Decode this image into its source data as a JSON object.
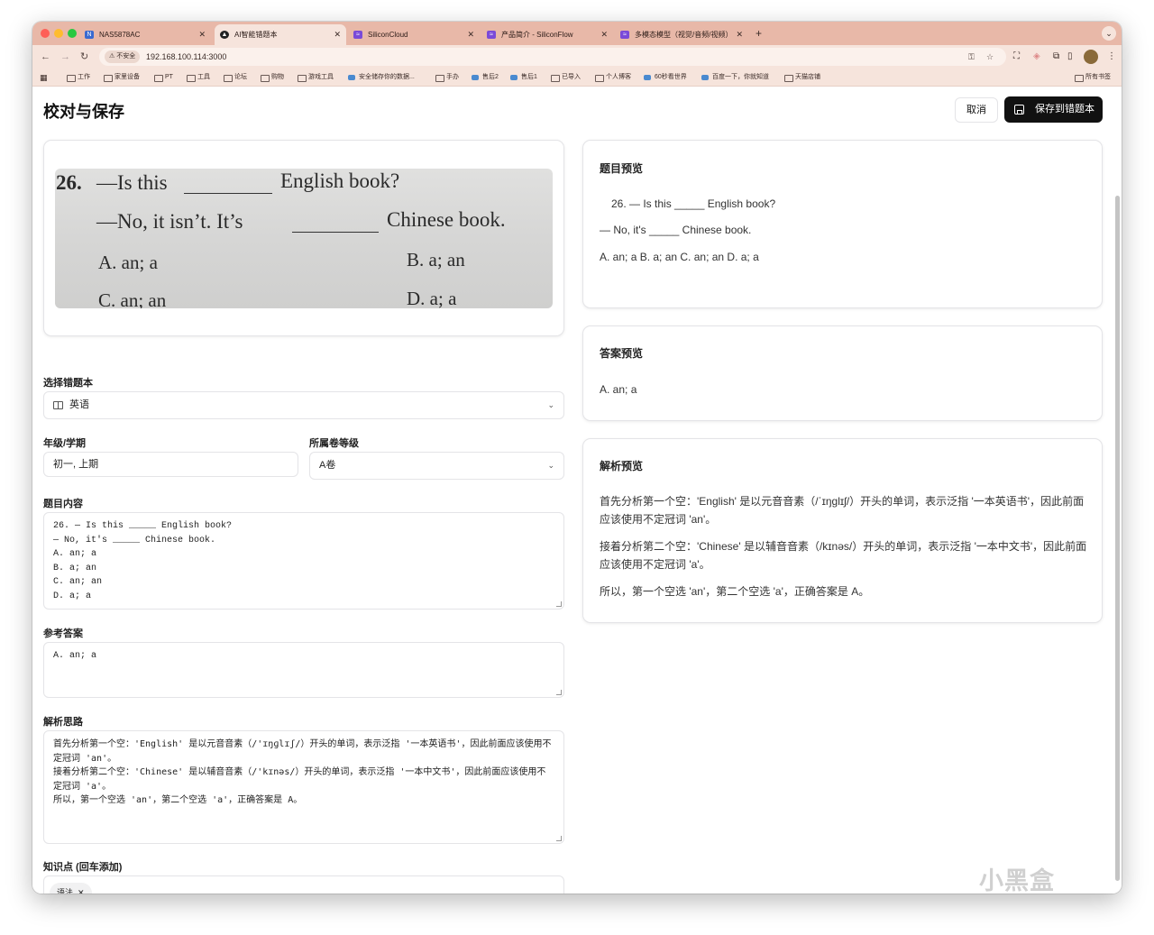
{
  "browser": {
    "tabs": [
      {
        "title": "NAS5878AC",
        "icon": "nas-icon",
        "color": "#3a6ad0"
      },
      {
        "title": "AI智能错题本",
        "icon": "app-icon",
        "color": "#222222"
      },
      {
        "title": "SiliconCloud",
        "icon": "siliconflow-icon",
        "color": "#7a4ad8"
      },
      {
        "title": "产品简介 - SiliconFlow",
        "icon": "siliconflow-icon",
        "color": "#7a4ad8"
      },
      {
        "title": "多模态模型（视觉/音频/视频）",
        "icon": "siliconflow-icon",
        "color": "#7a4ad8"
      }
    ],
    "new_tab": "+",
    "security_label": "不安全",
    "url": "192.168.100.114:3000",
    "bookmarks": [
      "工作",
      "家里设备",
      "PT",
      "工具",
      "论坛",
      "购物",
      "游戏工具",
      "安全储存你的数据...",
      "手办",
      "售后2",
      "售后1",
      "已导入",
      "个人博客",
      "60秒看世界",
      "百度一下，你就知道",
      "天猫店铺"
    ],
    "all_bookmarks": "所有书签"
  },
  "page": {
    "title": "校对与保存",
    "cancel_label": "取消",
    "save_label": "保存到错题本"
  },
  "photo": {
    "line1_num": "26.",
    "line1_a": "—Is this",
    "line1_b": "English book?",
    "line2_a": "—No, it isn’t.  It’s",
    "line2_b": "Chinese book.",
    "opt_a": "A.  an; a",
    "opt_b": "B.  a; an",
    "opt_c": "C.  an; an",
    "opt_d": "D.  a; a"
  },
  "form": {
    "notebook_label": "选择错题本",
    "notebook_value": "英语",
    "grade_label": "年级/学期",
    "grade_value": "初一, 上期",
    "level_label": "所属卷等级",
    "level_value": "A卷",
    "question_label": "题目内容",
    "question_value": "26. — Is this _____ English book?\n— No, it's _____ Chinese book.\nA. an; a\nB. a; an\nC. an; an\nD. a; a",
    "answer_label": "参考答案",
    "answer_value": "A. an; a",
    "analysis_label": "解析思路",
    "analysis_value": "首先分析第一个空：'English' 是以元音音素（/'ɪŋɡlɪʃ/）开头的单词，表示泛指 '一本英语书'，因此前面应该使用不定冠词 'an'。\n接着分析第二个空：'Chinese' 是以辅音音素（/'kɪnəs/）开头的单词，表示泛指 '一本中文书'，因此前面应该使用不定冠词 'a'。\n所以，第一个空选 'an'，第二个空选 'a'，正确答案是 A。",
    "knowledge_label": "知识点 (回车添加)",
    "knowledge_tags": [
      "语法"
    ]
  },
  "preview": {
    "question_title": "题目预览",
    "question_line1": "26. — Is this _____ English book?",
    "question_line2": "— No, it's _____ Chinese book.",
    "question_line3": "A. an; a B. a; an C. an; an D. a; a",
    "answer_title": "答案预览",
    "answer_text": "A. an; a",
    "analysis_title": "解析预览",
    "analysis_p1": "首先分析第一个空：'English' 是以元音音素（/ˈɪŋɡlɪʃ/）开头的单词，表示泛指 '一本英语书'，因此前面应该使用不定冠词 'an'。",
    "analysis_p2": "接着分析第二个空：'Chinese' 是以辅音音素（/kɪnəs/）开头的单词，表示泛指 '一本中文书'，因此前面应该使用不定冠词 'a'。",
    "analysis_p3": "所以，第一个空选 'an'，第二个空选 'a'，正确答案是 A。"
  },
  "watermark": "小黑盒"
}
